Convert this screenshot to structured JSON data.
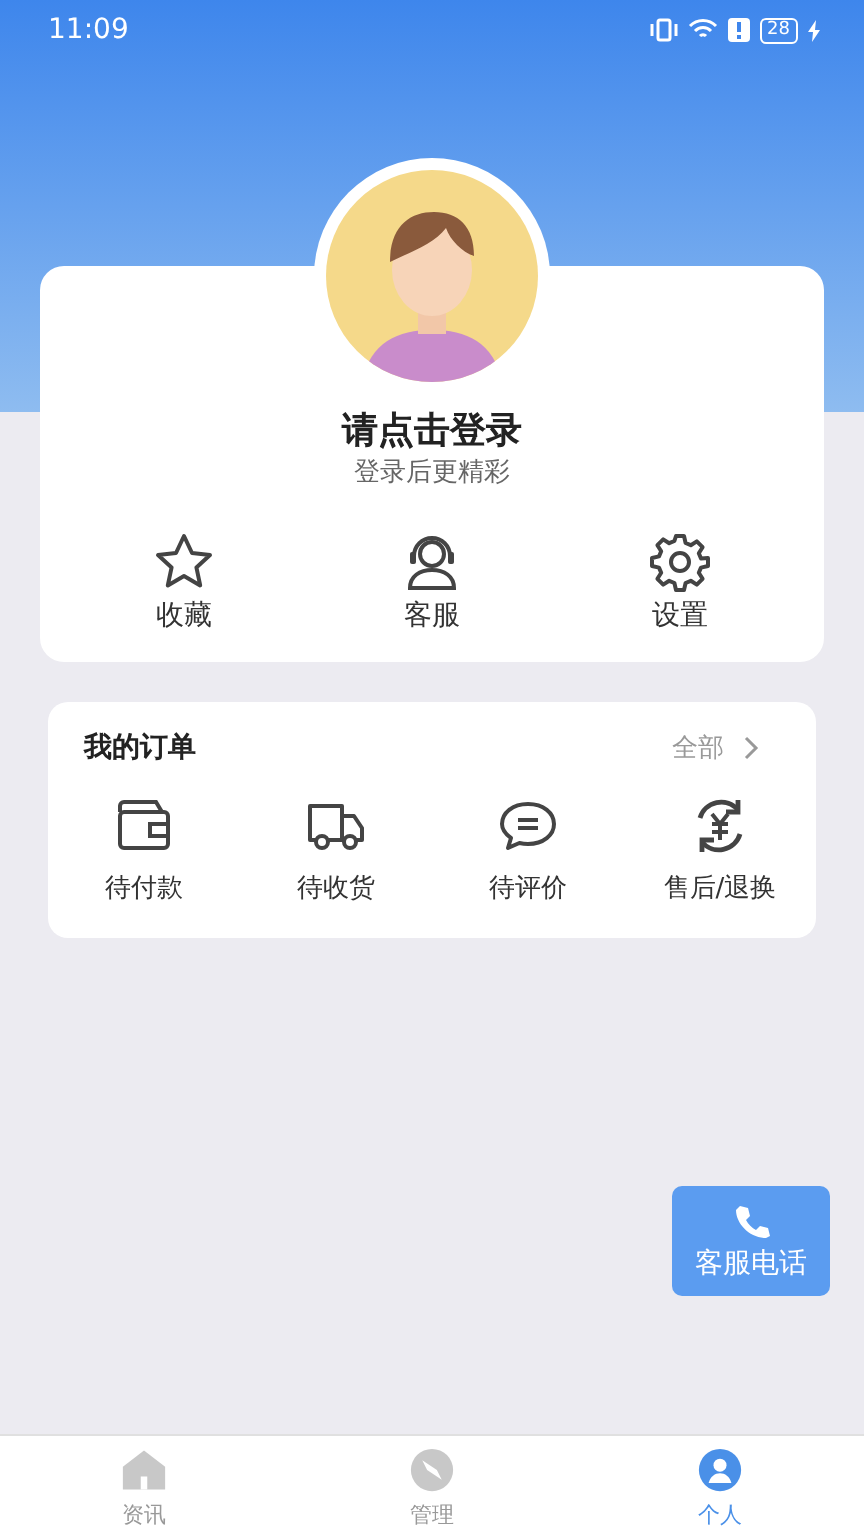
{
  "status_bar": {
    "time": "11:09",
    "battery": "28"
  },
  "profile": {
    "login_prompt": "请点击登录",
    "subtitle": "登录后更精彩",
    "actions": [
      {
        "kind": "star",
        "label": "收藏"
      },
      {
        "kind": "headset",
        "label": "客服"
      },
      {
        "kind": "gear",
        "label": "设置"
      }
    ]
  },
  "orders": {
    "title": "我的订单",
    "all_link": "全部",
    "items": [
      {
        "kind": "wallet",
        "label": "待付款"
      },
      {
        "kind": "truck",
        "label": "待收货"
      },
      {
        "kind": "chat",
        "label": "待评价"
      },
      {
        "kind": "refund",
        "label": "售后/退换"
      }
    ]
  },
  "float_button": {
    "label": "客服电话"
  },
  "tab_bar": [
    {
      "kind": "home",
      "label": "资讯",
      "selected": false
    },
    {
      "kind": "compass",
      "label": "管理",
      "selected": false
    },
    {
      "kind": "person",
      "label": "个人",
      "selected": true
    }
  ]
}
